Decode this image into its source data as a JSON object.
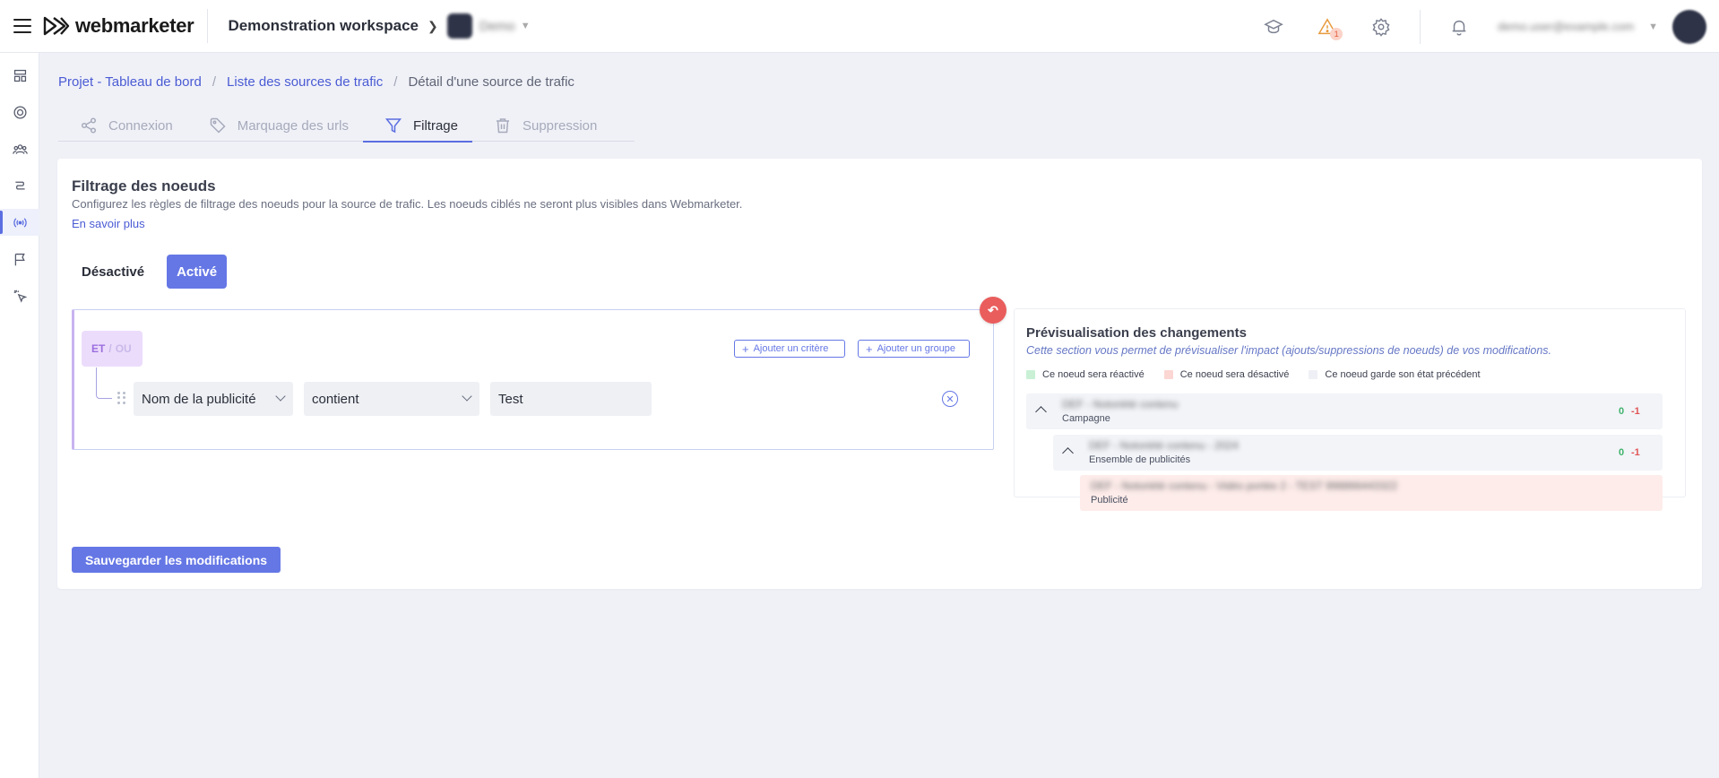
{
  "app": {
    "logo_text": "webmarketer",
    "workspace_name": "Demonstration workspace",
    "project_name": "Demo",
    "user_email": "demo.user@example.com",
    "warning_count": "1"
  },
  "sidebar": {
    "items": [
      {
        "icon": "dashboard-icon"
      },
      {
        "icon": "coin-icon"
      },
      {
        "icon": "users-icon"
      },
      {
        "icon": "route-icon"
      },
      {
        "icon": "broadcast-icon",
        "active": true
      },
      {
        "icon": "flag-icon"
      },
      {
        "icon": "cursor-click-icon"
      }
    ]
  },
  "breadcrumb": {
    "items": [
      "Projet - Tableau de bord",
      "Liste des sources de trafic",
      "Détail d'une source de trafic"
    ]
  },
  "tabs": [
    {
      "label": "Connexion",
      "icon": "share-icon"
    },
    {
      "label": "Marquage des urls",
      "icon": "tag-icon"
    },
    {
      "label": "Filtrage",
      "icon": "filter-icon",
      "active": true
    },
    {
      "label": "Suppression",
      "icon": "trash-icon"
    }
  ],
  "filtering": {
    "title": "Filtrage des noeuds",
    "description": "Configurez les règles de filtrage des noeuds pour la source de trafic. Les noeuds ciblés ne seront plus visibles dans Webmarketer.",
    "learn_more": "En savoir plus",
    "toggle_off": "Désactivé",
    "toggle_on": "Activé",
    "logic_and": "ET",
    "logic_sep": "/",
    "logic_or": "OU",
    "add_criterion": "Ajouter un critère",
    "add_group": "Ajouter un groupe",
    "criterion": {
      "field": "Nom de la publicité",
      "operator": "contient",
      "value": "Test"
    },
    "save_label": "Sauvegarder les modifications"
  },
  "preview": {
    "title": "Prévisualisation des changements",
    "subtitle": "Cette section vous permet de prévisualiser l'impact (ajouts/suppressions de noeuds) de vos modifications.",
    "legend": [
      {
        "label": "Ce noeud sera réactivé",
        "color": "#c9f0d5"
      },
      {
        "label": "Ce noeud sera désactivé",
        "color": "#fbd6d2"
      },
      {
        "label": "Ce noeud garde son état précédent",
        "color": "#eef0f5"
      }
    ],
    "nodes": [
      {
        "name": "DEF - Notoriété contenu",
        "type": "Campagne",
        "added": "0",
        "removed": "-1"
      },
      {
        "name": "DEF - Notoriété contenu - 2024",
        "type": "Ensemble de publicités",
        "added": "0",
        "removed": "-1"
      },
      {
        "name": "DEF - Notoriété contenu - Vidéo portée 2 - TEST 998866443322",
        "type": "Publicité"
      }
    ]
  },
  "colors": {
    "accent": "#6577e5",
    "link": "#4a5bd4",
    "danger": "#ea5d5d",
    "success": "#3fb26b"
  }
}
